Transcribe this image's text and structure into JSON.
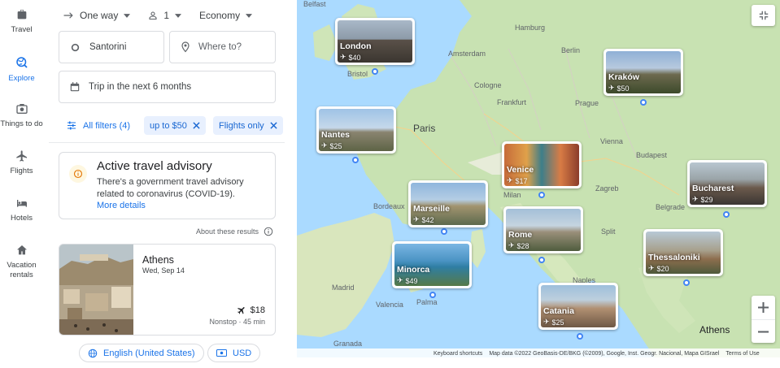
{
  "rail": {
    "travel": "Travel",
    "explore": "Explore",
    "things": "Things to do",
    "flights": "Flights",
    "hotels": "Hotels",
    "vacation": "Vacation rentals"
  },
  "search": {
    "trip_type": "One way",
    "passengers": "1",
    "cabin": "Economy",
    "origin": "Santorini",
    "destination_placeholder": "Where to?",
    "dates": "Trip in the next 6 months"
  },
  "filters": {
    "all": "All filters (4)",
    "price": "up to $50",
    "flights_only": "Flights only"
  },
  "advisory": {
    "title": "Active travel advisory",
    "body": "There's a government travel advisory related to coronavirus (COVID-19).",
    "link": "More details"
  },
  "about": "About these results",
  "result": {
    "city": "Athens",
    "date": "Wed, Sep 14",
    "price": "$18",
    "meta": "Nonstop · 45 min"
  },
  "footer": {
    "language": "English (United States)",
    "currency": "USD"
  },
  "map": {
    "destinations": [
      {
        "name": "London",
        "price": "$40"
      },
      {
        "name": "Kraków",
        "price": "$50"
      },
      {
        "name": "Nantes",
        "price": "$25"
      },
      {
        "name": "Venice",
        "price": "$17"
      },
      {
        "name": "Bucharest",
        "price": "$29"
      },
      {
        "name": "Marseille",
        "price": "$42"
      },
      {
        "name": "Rome",
        "price": "$28"
      },
      {
        "name": "Thessaloniki",
        "price": "$20"
      },
      {
        "name": "Minorca",
        "price": "$49"
      },
      {
        "name": "Catania",
        "price": "$25"
      }
    ],
    "labels": {
      "belfast": "Belfast",
      "hamburg": "Hamburg",
      "berlin": "Berlin",
      "amsterdam": "Amsterdam",
      "bristol": "Bristol",
      "cologne": "Cologne",
      "frankfurt": "Frankfurt",
      "prague": "Prague",
      "paris": "Paris",
      "vienna": "Vienna",
      "budapest": "Budapest",
      "zagreb": "Zagreb",
      "milan": "Milan",
      "bordeaux": "Bordeaux",
      "belgrade": "Belgrade",
      "split": "Split",
      "madrid": "Madrid",
      "valencia": "Valencia",
      "palma": "Palma",
      "naples": "Naples",
      "granada": "Granada",
      "athens": "Athens"
    },
    "attribution": {
      "shortcuts": "Keyboard shortcuts",
      "data": "Map data ©2022 GeoBasis-DE/BKG (©2009), Google, Inst. Geogr. Nacional, Mapa GISrael",
      "terms": "Terms of Use"
    }
  }
}
